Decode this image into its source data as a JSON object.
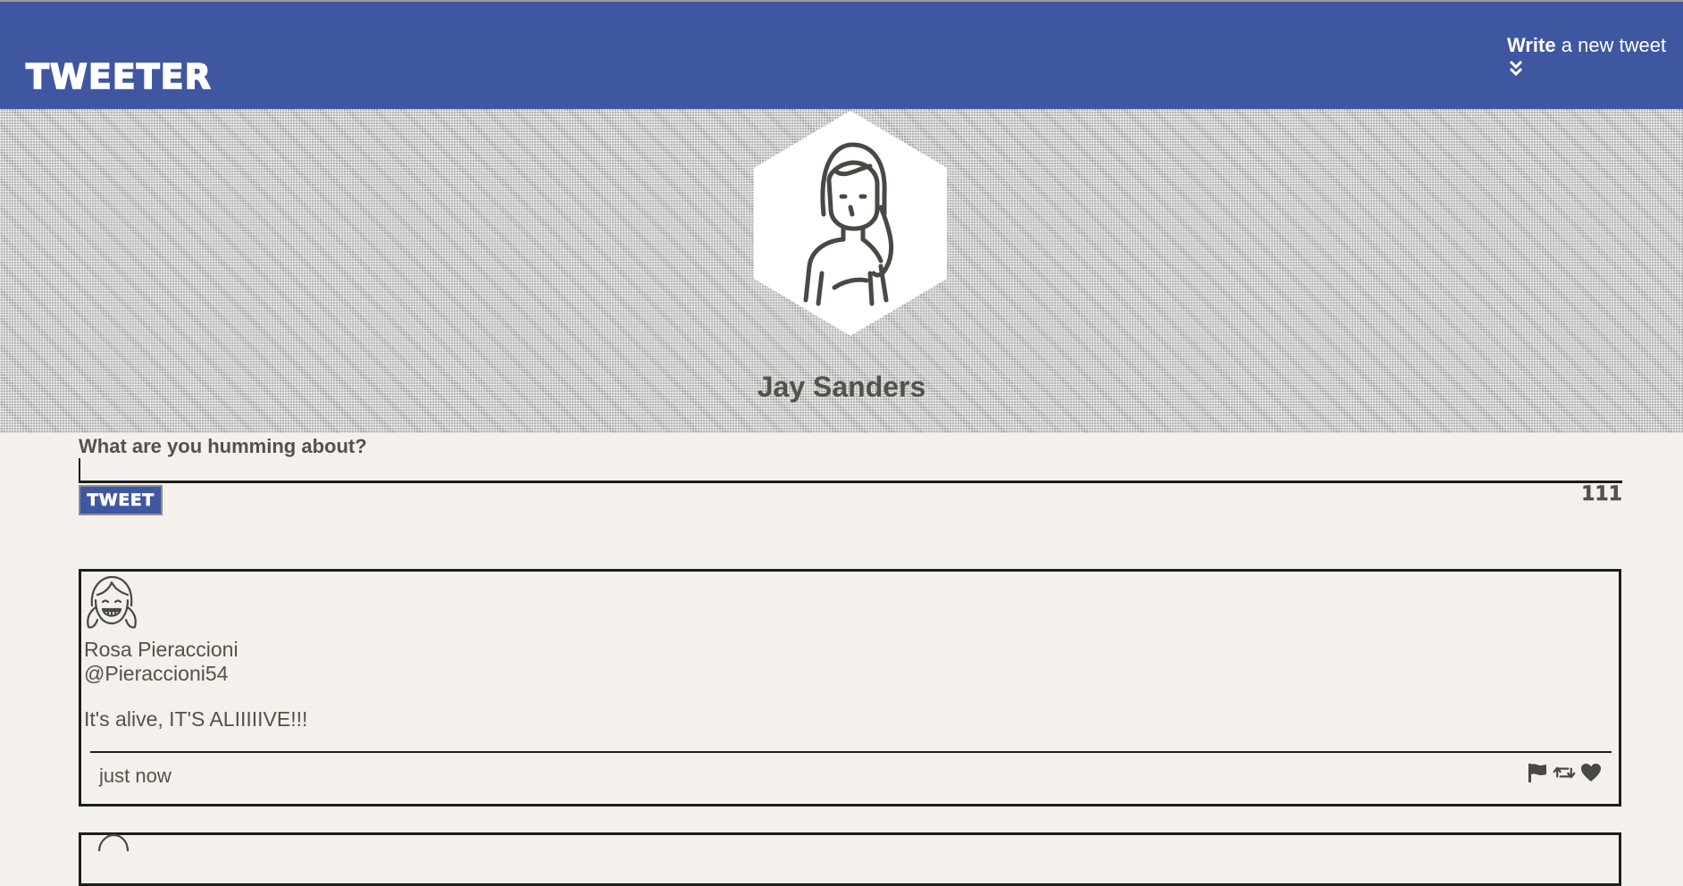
{
  "nav": {
    "brand": "TWEETER",
    "compose_toggle_bold": "Write",
    "compose_toggle_rest": "a new tweet",
    "toggle_icon": "double-chevron-down-icon"
  },
  "profile": {
    "name": "Jay Sanders",
    "avatar_icon": "woman-avatar-icon"
  },
  "compose": {
    "label": "What are you humming about?",
    "input_value": "",
    "button_label": "TWEET",
    "char_counter": "111"
  },
  "tweets": [
    {
      "author_name": "Rosa Pieraccioni",
      "handle": "@Pieraccioni54",
      "text": "It's alive, IT'S ALIIIIIVE!!!",
      "timestamp": "just now",
      "avatar_icon": "girl-avatar-icon",
      "actions": [
        "flag-icon",
        "retweet-icon",
        "heart-icon"
      ]
    }
  ],
  "colors": {
    "nav_background": "#3f57a0",
    "page_background": "#f4f1ec",
    "text": "#545149",
    "border": "#1d1d1d"
  }
}
